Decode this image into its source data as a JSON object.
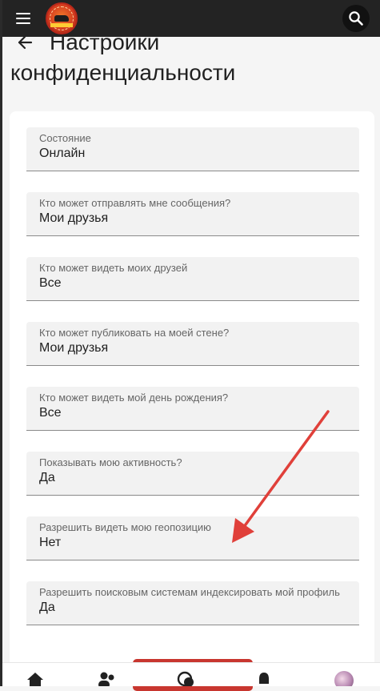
{
  "header": {
    "menu_icon": "hamburger-menu-icon",
    "logo_icon": "site-logo",
    "search_icon": "search-icon"
  },
  "page": {
    "back_icon": "arrow-left-icon",
    "title_line1": "Настройки",
    "title_line2": "конфиденциальности"
  },
  "settings": [
    {
      "label": "Состояние",
      "value": "Онлайн"
    },
    {
      "label": "Кто может отправлять мне сообщения?",
      "value": "Мои друзья"
    },
    {
      "label": "Кто может видеть моих друзей",
      "value": "Все"
    },
    {
      "label": "Кто может публиковать на моей стене?",
      "value": "Мои друзья"
    },
    {
      "label": "Кто может видеть мой день рождения?",
      "value": "Все"
    },
    {
      "label": "Показывать мою активность?",
      "value": "Да"
    },
    {
      "label": "Разрешить видеть мою геопозицию",
      "value": "Нет"
    },
    {
      "label": "Разрешить поисковым системам индексировать мой профиль",
      "value": "Да"
    }
  ],
  "bottom_nav": {
    "items": [
      "home-icon",
      "friends-icon",
      "messages-icon",
      "notifications-icon",
      "profile-avatar"
    ]
  },
  "colors": {
    "top_bar": "#232323",
    "background": "#f5f5f5",
    "field_background": "#f2f2f2",
    "accent_button": "#c8362f",
    "annotation_arrow": "#e0403a"
  }
}
